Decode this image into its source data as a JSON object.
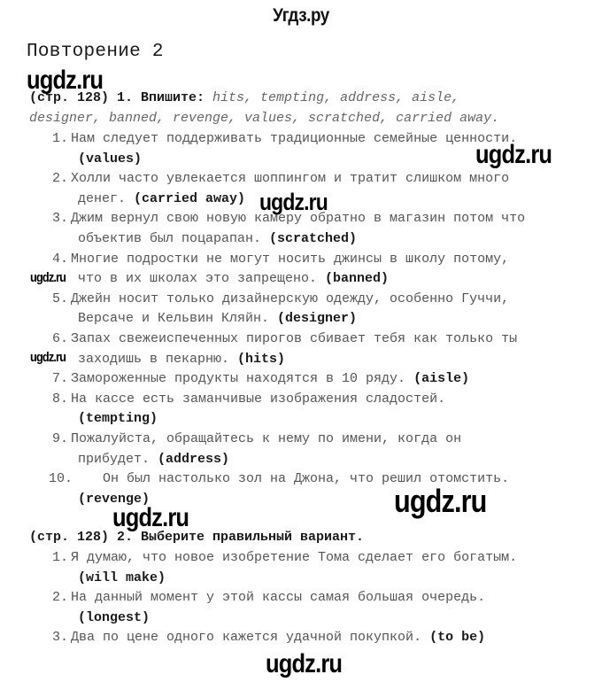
{
  "site_title": "Угдз.ру",
  "heading": "Повторение 2",
  "watermark": "ugdz.ru",
  "task1": {
    "label": "(стр. 128) 1. Впишите:",
    "words_line1": " hits, tempting, address, aisle,",
    "words_line2": "designer, banned, revenge, values, scratched, carried away.",
    "items": [
      {
        "num": "1.",
        "line1": "Нам следует поддерживать традиционные семейные ценности.",
        "line2": "",
        "answer": "(values)"
      },
      {
        "num": "2.",
        "line1": "Холли часто увлекается шоппингом и тратит слишком много",
        "line2": "денег. ",
        "answer": "(carried away)"
      },
      {
        "num": "3.",
        "line1": "Джим вернул свою новую камеру обратно в магазин потом что",
        "line2": "объектив был поцарапан. ",
        "answer": "(scratched)"
      },
      {
        "num": "4.",
        "line1": "Многие подростки не могут носить джинсы в школу потому,",
        "line2": "что в их школах это запрещено. ",
        "answer": "(banned)"
      },
      {
        "num": "5.",
        "line1": "Джейн носит только дизайнерскую одежду, особенно Гуччи,",
        "line2": "Версаче и Кельвин Кляйн. ",
        "answer": "(designer)"
      },
      {
        "num": "6.",
        "line1": "Запах свежеиспеченных пирогов сбивает тебя как только ты",
        "line2": "заходишь в пекарню. ",
        "answer": "(hits)"
      },
      {
        "num": "7.",
        "line1": "Замороженные продукты находятся в 10 ряду. ",
        "line2": "",
        "answer": "(aisle)"
      },
      {
        "num": "8.",
        "line1": "На кассе есть заманчивые изображения сладостей.",
        "line2": "",
        "answer": "(tempting)"
      },
      {
        "num": "9.",
        "line1": "Пожалуйста, обращайтесь к нему по имени, когда он",
        "line2": "прибудет. ",
        "answer": "(address)"
      },
      {
        "num": "10.",
        "line1": "    Он был настолько зол на Джона, что решил отомстить.",
        "line2": "",
        "answer": "(revenge)"
      }
    ]
  },
  "task2": {
    "label": "(стр. 128) 2. Выберите правильный вариант.",
    "items": [
      {
        "num": "1.",
        "line1": "Я думаю, что новое изобретение Тома сделает его богатым.",
        "line2": "",
        "answer": "(will make)"
      },
      {
        "num": "2.",
        "line1": "На данный момент у этой кассы самая большая очередь.",
        "line2": "",
        "answer": "(longest)"
      },
      {
        "num": "3.",
        "line1": "Два по цене одного кажется удачной покупкой. ",
        "line2": "",
        "answer": "(to be)"
      }
    ]
  }
}
